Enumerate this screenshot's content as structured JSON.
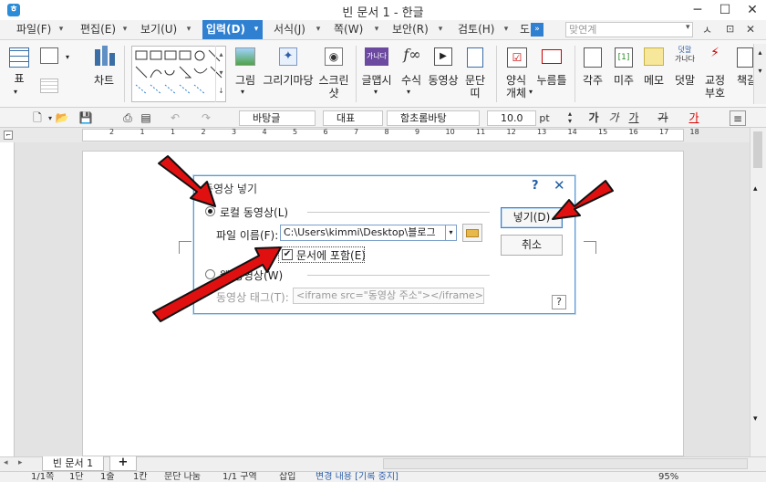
{
  "window": {
    "title": "빈 문서 1 - 한글",
    "minimize": "─",
    "maximize": "☐",
    "close": "✕"
  },
  "menu": {
    "items": [
      {
        "label": "파일(F)",
        "caret": "▾"
      },
      {
        "label": "편집(E)",
        "caret": "▾"
      },
      {
        "label": "보기(U)",
        "caret": "▾"
      },
      {
        "label": "입력(D)",
        "caret": "▾"
      },
      {
        "label": "서식(J)",
        "caret": "▾"
      },
      {
        "label": "쪽(W)",
        "caret": "▾"
      },
      {
        "label": "보안(R)",
        "caret": "▾"
      },
      {
        "label": "검토(H)",
        "caret": "▾"
      },
      {
        "label": "도",
        "caret": ""
      }
    ],
    "more": "»",
    "style_combo_placeholder": "맞연계"
  },
  "ribbon": {
    "table_label": "표",
    "chart_label": "차트",
    "picture_label": "그림",
    "drawing_label": "그리기마당",
    "screenshot_label_1": "스크린",
    "screenshot_label_2": "샷",
    "glyph_label": "글맵시",
    "equation_label": "수식",
    "video_label": "동영상",
    "paragraph_label_1": "문단",
    "paragraph_label_2": "띠",
    "form_label_1": "양식",
    "form_label_2": "개체",
    "button_label": "누름틀",
    "footnote_label": "각주",
    "endnote_label": "미주",
    "memo_label": "메모",
    "overlay_label": "덧말",
    "overlay_icon_1": "덧말",
    "overlay_icon_2": "가나다",
    "proof_label_1": "교정",
    "proof_label_2": "부호",
    "bookmark_label": "책갈",
    "glyph_icon_text": "가나다"
  },
  "format_bar": {
    "style": "바탕글",
    "language": "대표",
    "font": "함초롬바탕",
    "size": "10.0",
    "unit": "pt",
    "bold": "가",
    "italic": "가",
    "underline": "가",
    "strike": "가",
    "color": "가"
  },
  "ruler": {
    "labels": [
      "2",
      "1",
      "1",
      "2",
      "3",
      "4",
      "5",
      "6",
      "7",
      "8",
      "9",
      "10",
      "11",
      "12",
      "13",
      "14",
      "15",
      "16",
      "17",
      "18"
    ]
  },
  "dialog": {
    "title": "동영상 넣기",
    "help": "?",
    "close": "✕",
    "local_video_label": "로컬 동영상(L)",
    "file_name_label": "파일 이름(F):",
    "file_name_value": "C:\\Users\\kimmi\\Desktop\\블로그",
    "embed_label": "문서에 포함(E)",
    "embed_checked": true,
    "web_video_label": "웹 동영상(W)",
    "video_tag_label": "동영상 태그(T):",
    "video_tag_placeholder": "<iframe src=\"동영상 주소\"></iframe>",
    "insert_button": "넣기(D)",
    "cancel_button": "취소",
    "small_help": "?"
  },
  "tabs": {
    "document_tab": "빈 문서 1",
    "add_tab": "+"
  },
  "status": {
    "page": "1/1쪽",
    "section": "1단",
    "line": "1줄",
    "column": "1칸",
    "break": "문단 나눔",
    "sections": "1/1 구역",
    "insert_mode": "삽입",
    "track": "변경 내용 [기록 중지]",
    "zoom": "95%"
  },
  "colors": {
    "accent": "#2f80d1",
    "arrow_fill": "#e01010",
    "dialog_border": "#5a9bd4"
  }
}
